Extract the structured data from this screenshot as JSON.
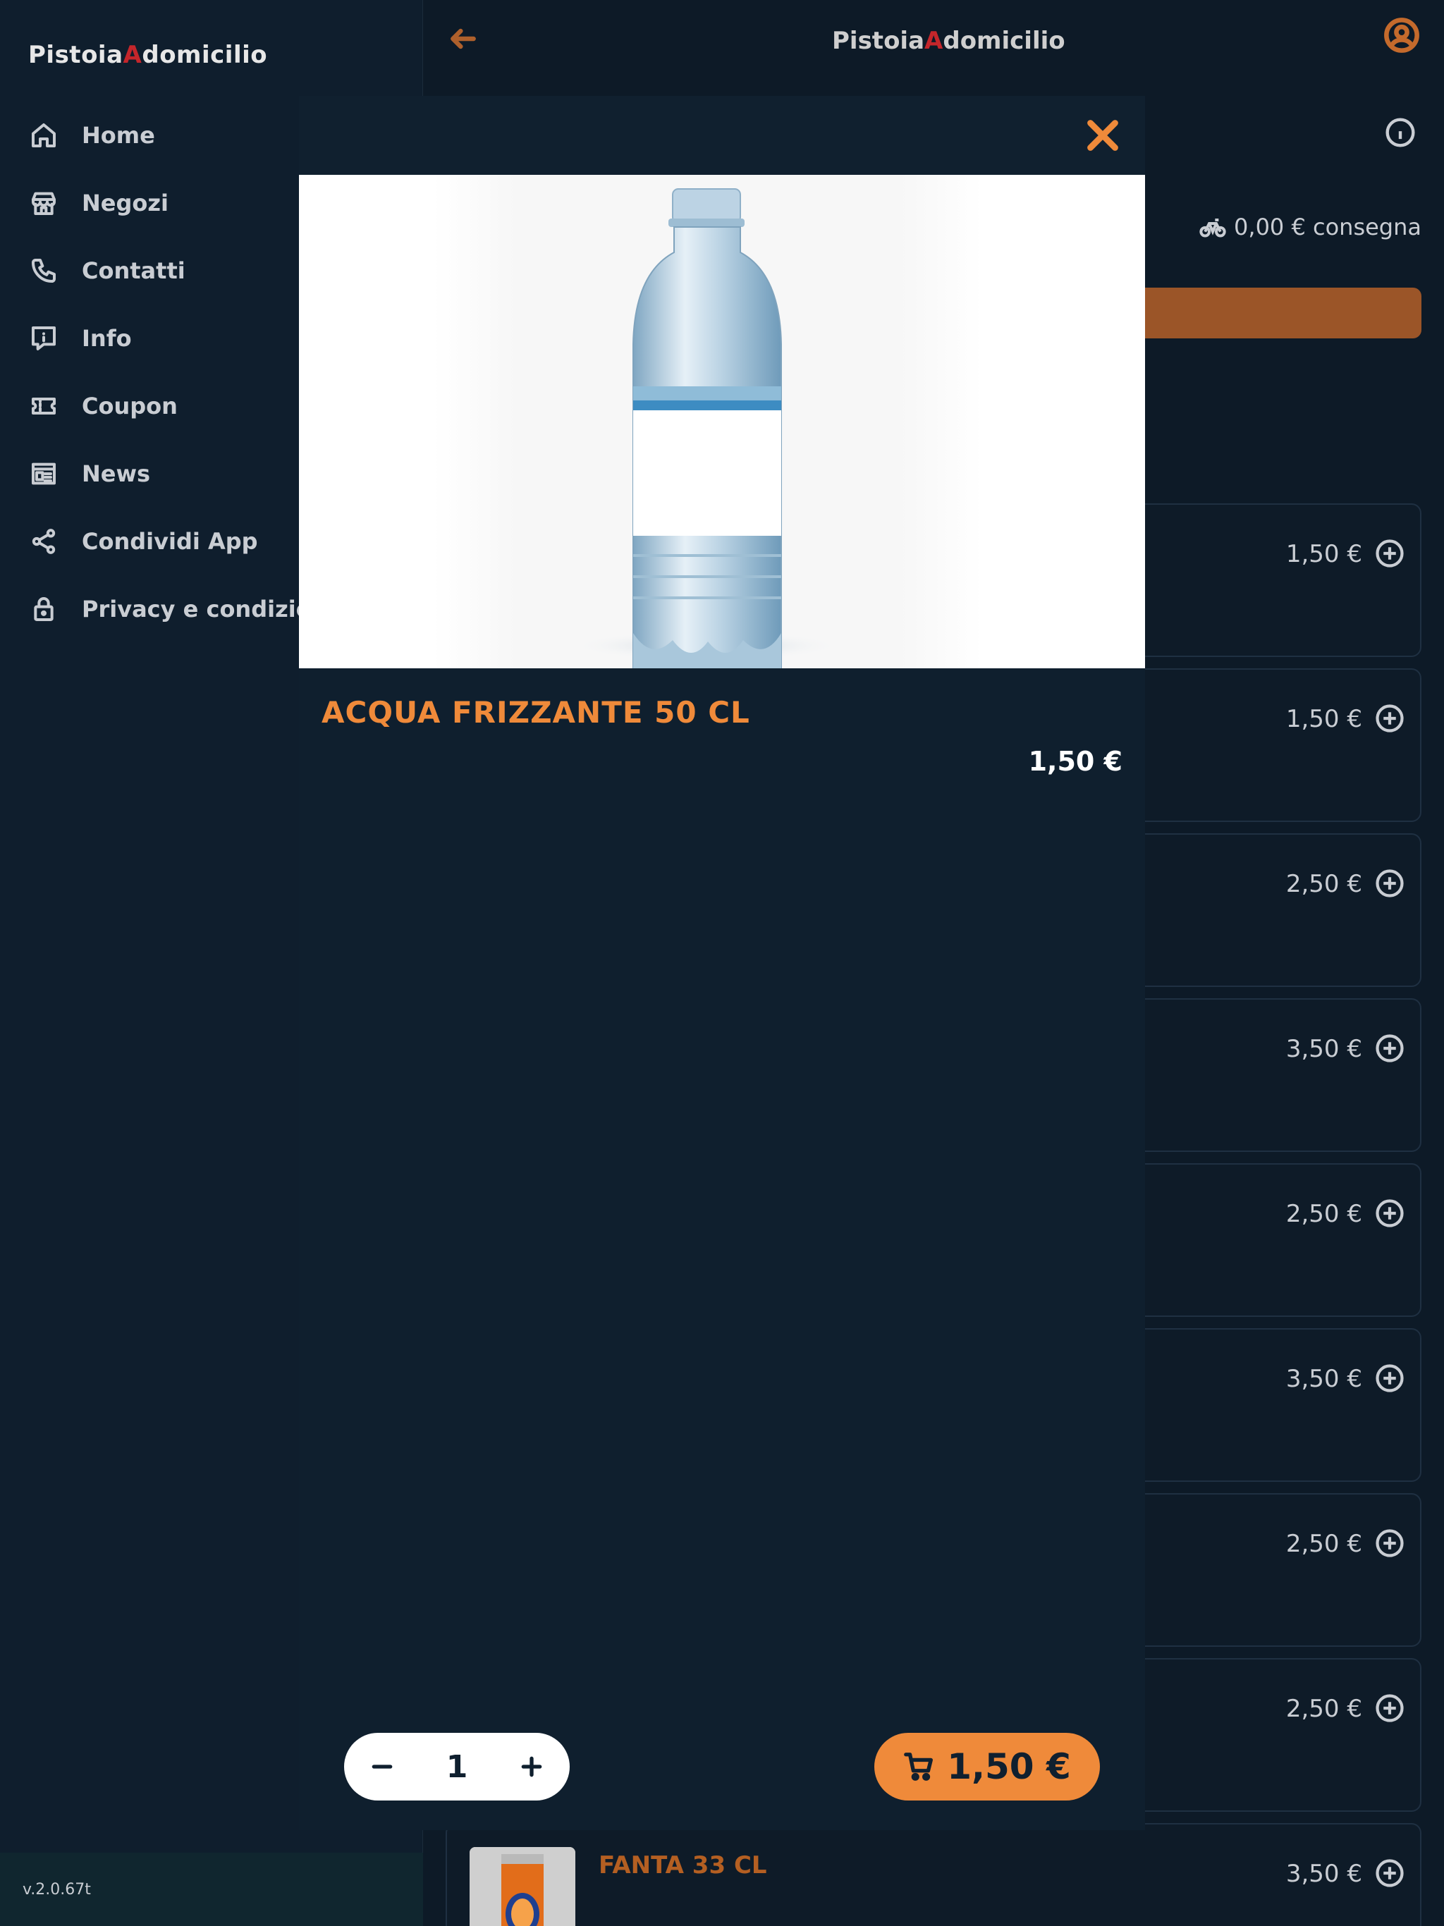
{
  "app": {
    "logo_part1": "Pistoia",
    "logo_accent": "A",
    "logo_part2": "domicilio"
  },
  "sidebar": {
    "items": [
      {
        "label": "Home",
        "icon": "home-icon"
      },
      {
        "label": "Negozi",
        "icon": "store-icon"
      },
      {
        "label": "Contatti",
        "icon": "phone-icon"
      },
      {
        "label": "Info",
        "icon": "info-message-icon"
      },
      {
        "label": "Coupon",
        "icon": "ticket-icon"
      },
      {
        "label": "News",
        "icon": "news-icon"
      },
      {
        "label": "Condividi App",
        "icon": "share-icon"
      },
      {
        "label": "Privacy e condizioni",
        "icon": "lock-icon"
      }
    ],
    "version": "v.2.0.67t"
  },
  "shop": {
    "delivery": "0,00 € consegna"
  },
  "products": [
    {
      "price": "1,50 €"
    },
    {
      "price": "1,50 €"
    },
    {
      "price": "2,50 €"
    },
    {
      "price": "3,50 €"
    },
    {
      "price": "2,50 €"
    },
    {
      "price": "3,50 €"
    },
    {
      "price": "2,50 €"
    },
    {
      "price": "2,50 €"
    },
    {
      "name": "FANTA 33 CL",
      "price": "3,50 €"
    }
  ],
  "modal": {
    "title": "ACQUA FRIZZANTE 50 CL",
    "price": "1,50 €",
    "quantity": "1",
    "add_to_cart_price": "1,50 €"
  },
  "colors": {
    "accent": "#ef8a3a",
    "background": "#0d1a27",
    "logo_red": "#c4262b"
  }
}
